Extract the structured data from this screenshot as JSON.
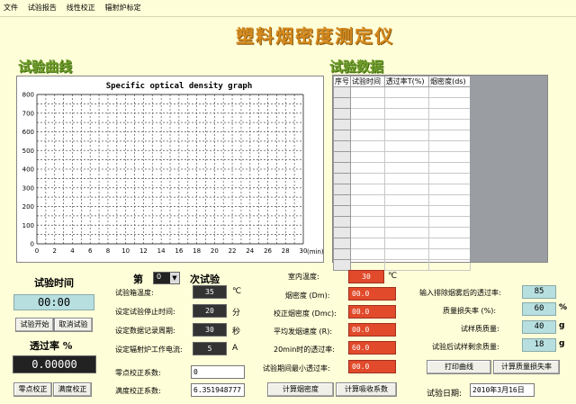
{
  "menu": [
    "文件",
    "试验报告",
    "线性校正",
    "辐射炉标定"
  ],
  "app_title": "塑料烟密度测定仪",
  "curve_title": "试验曲线",
  "data_title": "试验数据",
  "chart_data": {
    "type": "line",
    "title": "Specific optical density graph",
    "xlabel": "(min)",
    "ylabel": "",
    "xlim": [
      0,
      30
    ],
    "ylim": [
      0,
      800
    ],
    "x_ticks": [
      0,
      2,
      4,
      6,
      8,
      10,
      12,
      14,
      16,
      18,
      20,
      22,
      24,
      26,
      28,
      30
    ],
    "y_ticks": [
      0,
      100,
      200,
      300,
      400,
      500,
      600,
      700,
      800
    ],
    "grid": true,
    "series": []
  },
  "table": {
    "headers": [
      "序号",
      "试验时间",
      "透过率T(%)",
      "烟密度(ds)"
    ],
    "row_count": 17
  },
  "left": {
    "test_time_label": "试验时间",
    "test_time_value": "00:00",
    "start_button": "试验开始",
    "cancel_button": "取消试验",
    "transmittance_label": "透过率 %",
    "transmittance_value": "0.00000",
    "zero_button": "零点校正",
    "full_button": "满度校正"
  },
  "middle": {
    "run_prefix": "第",
    "run_number": "0",
    "run_suffix": "次试验",
    "rows": [
      {
        "label": "试验箱温度:",
        "value": "35",
        "unit": "℃"
      },
      {
        "label": "设定试验停止时间:",
        "value": "20",
        "unit": "分"
      },
      {
        "label": "设定数据记录周期:",
        "value": "30",
        "unit": "秒"
      },
      {
        "label": "设定辐射炉工作电流:",
        "value": "5",
        "unit": "A"
      }
    ],
    "zero_coef_label": "零点校正系数:",
    "zero_coef_value": "0",
    "full_coef_label": "满度校正系数:",
    "full_coef_value": "6.351948777"
  },
  "center": {
    "room_temp_label": "室内温度:",
    "room_temp_value": "30",
    "room_temp_unit": "℃",
    "rows": [
      {
        "label": "烟密度 (Dm):",
        "value": "00.0"
      },
      {
        "label": "校正烟密度 (Dmc):",
        "value": "00.0"
      },
      {
        "label": "平均发烟速度 (R):",
        "value": "00.0"
      },
      {
        "label": "20min时的透过率:",
        "value": "60.0"
      },
      {
        "label": "试验期间最小透过率:",
        "value": "00.0"
      }
    ],
    "calc_density_button": "计算烟密度",
    "calc_absorb_button": "计算吸收系数"
  },
  "right": {
    "rows": [
      {
        "label": "输入排除烟雾后的透过率:",
        "value": "85",
        "unit": ""
      },
      {
        "label": "质量损失率 (%):",
        "value": "60",
        "unit": "%"
      },
      {
        "label": "试样质质量:",
        "value": "40",
        "unit": "g"
      },
      {
        "label": "试验后试样剩余质量:",
        "value": "18",
        "unit": "g"
      }
    ],
    "print_button": "打印曲线",
    "mass_loss_button": "计算质量损失率",
    "date_label": "试验日期:",
    "date_value": "2010年3月16日"
  },
  "colors": {
    "background": "#fefed8",
    "title_orange": "#d58a1e",
    "section_green": "#6f9c2a",
    "value_red": "#e14a2a",
    "value_cyan": "#b8dfe0"
  }
}
